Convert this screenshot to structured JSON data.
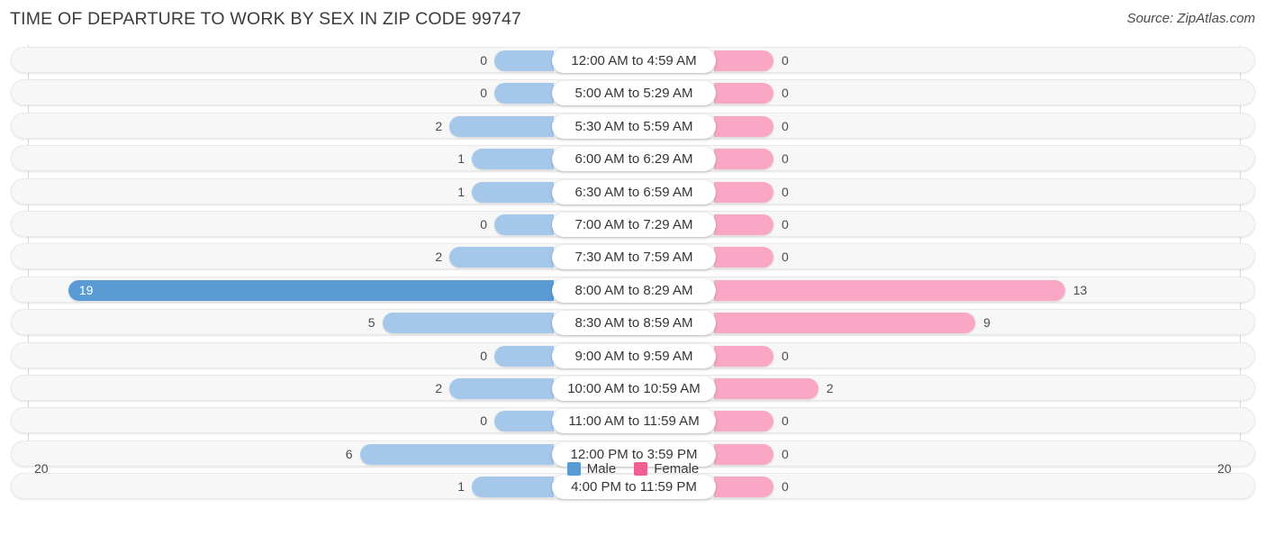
{
  "header": {
    "title": "TIME OF DEPARTURE TO WORK BY SEX IN ZIP CODE 99747",
    "source": "Source: ZipAtlas.com"
  },
  "axis": {
    "left_label": "20",
    "right_label": "20"
  },
  "legend": {
    "items": [
      {
        "label": "Male",
        "color": "#5a9bd5"
      },
      {
        "label": "Female",
        "color": "#ef5f92"
      }
    ]
  },
  "colors": {
    "male_light": "#a5c8ea",
    "male_dark": "#5a9bd5",
    "female_light": "#f9a7c5",
    "female_dark": "#ef5f92",
    "row_track": "#f7f7f7",
    "gridline": "#d8d8d8"
  },
  "chart_data": {
    "type": "bar",
    "title": "TIME OF DEPARTURE TO WORK BY SEX IN ZIP CODE 99747",
    "subtitle": "",
    "orientation": "horizontal",
    "style": "diverging-bidirectional",
    "xlabel": "",
    "ylabel": "",
    "xlim": [
      20,
      20
    ],
    "axis_tick_labels": [
      "20",
      "20"
    ],
    "grid": true,
    "legend_position": "bottom-center",
    "categories": [
      "12:00 AM to 4:59 AM",
      "5:00 AM to 5:29 AM",
      "5:30 AM to 5:59 AM",
      "6:00 AM to 6:29 AM",
      "6:30 AM to 6:59 AM",
      "7:00 AM to 7:29 AM",
      "7:30 AM to 7:59 AM",
      "8:00 AM to 8:29 AM",
      "8:30 AM to 8:59 AM",
      "9:00 AM to 9:59 AM",
      "10:00 AM to 10:59 AM",
      "11:00 AM to 11:59 AM",
      "12:00 PM to 3:59 PM",
      "4:00 PM to 11:59 PM"
    ],
    "series": [
      {
        "name": "Male",
        "values": [
          0,
          0,
          2,
          1,
          1,
          0,
          2,
          19,
          5,
          0,
          2,
          0,
          6,
          1
        ]
      },
      {
        "name": "Female",
        "values": [
          0,
          0,
          0,
          0,
          0,
          0,
          0,
          13,
          9,
          0,
          2,
          0,
          0,
          0
        ]
      }
    ]
  },
  "rows": [
    {
      "label": "12:00 AM to 4:59 AM",
      "male": "0",
      "female": "0"
    },
    {
      "label": "5:00 AM to 5:29 AM",
      "male": "0",
      "female": "0"
    },
    {
      "label": "5:30 AM to 5:59 AM",
      "male": "2",
      "female": "0"
    },
    {
      "label": "6:00 AM to 6:29 AM",
      "male": "1",
      "female": "0"
    },
    {
      "label": "6:30 AM to 6:59 AM",
      "male": "1",
      "female": "0"
    },
    {
      "label": "7:00 AM to 7:29 AM",
      "male": "0",
      "female": "0"
    },
    {
      "label": "7:30 AM to 7:59 AM",
      "male": "2",
      "female": "0"
    },
    {
      "label": "8:00 AM to 8:29 AM",
      "male": "19",
      "female": "13"
    },
    {
      "label": "8:30 AM to 8:59 AM",
      "male": "5",
      "female": "9"
    },
    {
      "label": "9:00 AM to 9:59 AM",
      "male": "0",
      "female": "0"
    },
    {
      "label": "10:00 AM to 10:59 AM",
      "male": "2",
      "female": "2"
    },
    {
      "label": "11:00 AM to 11:59 AM",
      "male": "0",
      "female": "0"
    },
    {
      "label": "12:00 PM to 3:59 PM",
      "male": "6",
      "female": "0"
    },
    {
      "label": "4:00 PM to 11:59 PM",
      "male": "1",
      "female": "0"
    }
  ]
}
